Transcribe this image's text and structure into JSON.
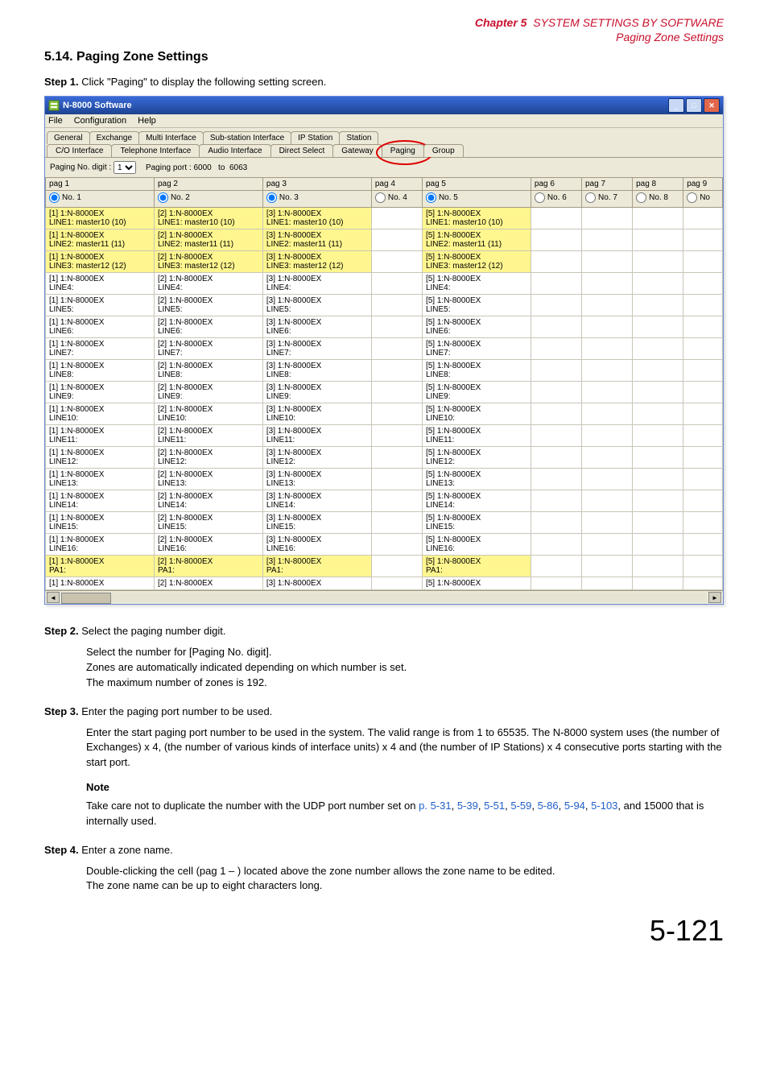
{
  "header": {
    "chapter": "Chapter 5",
    "title": "SYSTEM SETTINGS BY SOFTWARE",
    "subtitle": "Paging Zone Settings"
  },
  "section": {
    "heading": "5.14. Paging Zone Settings"
  },
  "steps": [
    {
      "label": "Step 1.",
      "text": "Click \"Paging\" to display the following setting screen."
    },
    {
      "label": "Step 2.",
      "text": "Select the paging number digit.",
      "body": [
        "Select the number for [Paging No. digit].",
        "Zones are automatically indicated depending on which number is set.",
        "The maximum number of zones is 192."
      ]
    },
    {
      "label": "Step 3.",
      "text": "Enter the paging port number to be used.",
      "body": [
        "Enter the start paging port number to be used in the system. The valid range is from 1 to 65535. The N-8000 system uses (the number of Exchanges) x 4, (the number of various kinds of interface units) x 4 and (the number of IP Stations) x 4 consecutive ports starting with the start port."
      ],
      "note_heading": "Note",
      "note_prefix": "Take care not to duplicate the number with the UDP port number set on ",
      "links": [
        "p. 5-31",
        "5-39",
        "5-51",
        "5-59",
        "5-86",
        "5-94",
        "5-103"
      ],
      "note_suffix": ", and 15000 that is internally used."
    },
    {
      "label": "Step 4.",
      "text": "Enter a zone name.",
      "body": [
        "Double-clicking the cell (pag 1 – ) located above the zone number allows the zone name to be edited.",
        "The zone name can be up to eight characters long."
      ]
    }
  ],
  "window": {
    "title": "N-8000 Software",
    "menu": [
      "File",
      "Configuration",
      "Help"
    ],
    "tabs1": [
      "General",
      "Exchange",
      "Multi Interface",
      "Sub-station Interface",
      "IP Station",
      "Station"
    ],
    "tabs2": [
      "C/O Interface",
      "Telephone Interface",
      "Audio Interface",
      "Direct Select",
      "Gateway",
      "Paging",
      "Group"
    ],
    "toolbar": {
      "paging_digit_label": "Paging No. digit :",
      "paging_digit_value": "1",
      "paging_port_label": "Paging port :",
      "paging_port_from": "6000",
      "paging_port_to_label": "to",
      "paging_port_to": "6063"
    },
    "grid": {
      "pagheaders": [
        "pag 1",
        "pag 2",
        "pag 3",
        "pag 4",
        "pag 5",
        "pag 6",
        "pag 7",
        "pag 8",
        "pag 9"
      ],
      "noheaders": [
        "No. 1",
        "No. 2",
        "No. 3",
        "No. 4",
        "No. 5",
        "No. 6",
        "No. 7",
        "No. 8",
        "No"
      ],
      "rows_meta": [
        {
          "line": "LINE1: master10 (10)",
          "ylw": true
        },
        {
          "line": "LINE2: master11 (11)",
          "ylw": true
        },
        {
          "line": "LINE3: master12 (12)",
          "ylw": true
        },
        {
          "line": "LINE4:",
          "ylw": false
        },
        {
          "line": "LINE5:",
          "ylw": false
        },
        {
          "line": "LINE6:",
          "ylw": false
        },
        {
          "line": "LINE7:",
          "ylw": false
        },
        {
          "line": "LINE8:",
          "ylw": false
        },
        {
          "line": "LINE9:",
          "ylw": false
        },
        {
          "line": "LINE10:",
          "ylw": false
        },
        {
          "line": "LINE11:",
          "ylw": false
        },
        {
          "line": "LINE12:",
          "ylw": false
        },
        {
          "line": "LINE13:",
          "ylw": false
        },
        {
          "line": "LINE14:",
          "ylw": false
        },
        {
          "line": "LINE15:",
          "ylw": false
        },
        {
          "line": "LINE16:",
          "ylw": false
        },
        {
          "line": "PA1:",
          "ylw": true
        }
      ],
      "cell_top": "1:N-8000EX",
      "col_prefixes": [
        "[1]",
        "[2]",
        "[3]",
        "",
        "[5]",
        "",
        "",
        "",
        ""
      ],
      "last_row_top_only": true
    }
  },
  "footer": {
    "page": "5-121"
  }
}
